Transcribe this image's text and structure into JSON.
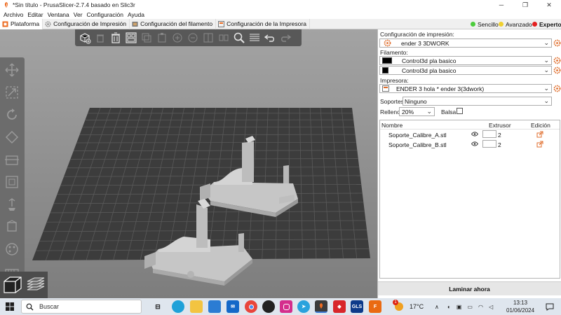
{
  "window": {
    "title": "*Sin título - PrusaSlicer-2.7.4 basado en Slic3r",
    "minimize": "─",
    "maximize": "❐",
    "close": "✕"
  },
  "menu": [
    "Archivo",
    "Editar",
    "Ventana",
    "Ver",
    "Configuración",
    "Ayuda"
  ],
  "tabs": [
    {
      "label": "Plataforma",
      "icon": "plater-icon",
      "active": true
    },
    {
      "label": "Configuración de Impresión",
      "icon": "gear-icon",
      "active": false
    },
    {
      "label": "Configuración del filamento",
      "icon": "spool-icon",
      "active": false
    },
    {
      "label": "Configuración de la Impresora",
      "icon": "printer-icon",
      "active": false
    }
  ],
  "modes": [
    {
      "label": "Sencillo",
      "color": "#4ccc3c"
    },
    {
      "label": "Avanzado",
      "color": "#f0d030"
    },
    {
      "label": "Experto",
      "color": "#e42020"
    }
  ],
  "panel": {
    "print_settings_label": "Configuración de impresión:",
    "print_settings_value": "ender 3 3DWORK",
    "filament_label": "Filamento:",
    "filament_1": "Control3d pla basico",
    "filament_2": "Control3d pla basico",
    "printer_label": "Impresora:",
    "printer_value": "ENDER 3 hola * ender 3(3dwork)",
    "supports_label": "Soportes:",
    "supports_value": "Ninguno",
    "infill_label": "Relleno:",
    "infill_value": "20%",
    "brim_label": "Balsa:",
    "brim_checked": false,
    "list_headers": {
      "name": "Nombre",
      "extruder": "Extrusor",
      "edit": "Edición"
    },
    "objects": [
      {
        "name": "Soporte_Calibre_A.stl",
        "extruder": "2"
      },
      {
        "name": "Soporte_Calibre_B.stl",
        "extruder": "2"
      }
    ],
    "slice_button": "Laminar ahora"
  },
  "taskbar": {
    "search_placeholder": "Buscar",
    "weather": "17°C",
    "time": "13:13",
    "date": "01/06/2024",
    "notification_count": "1"
  },
  "accent": "#ed6b21"
}
